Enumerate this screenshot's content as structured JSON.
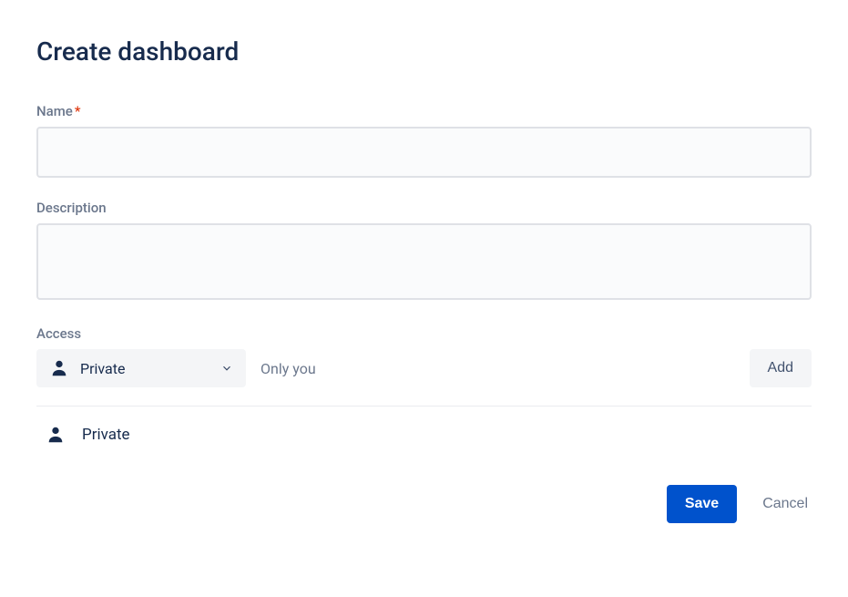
{
  "title": "Create dashboard",
  "fields": {
    "name": {
      "label": "Name",
      "required_marker": "*",
      "value": ""
    },
    "description": {
      "label": "Description",
      "value": ""
    },
    "access": {
      "label": "Access",
      "selected": "Private",
      "detail": "Only you",
      "add_label": "Add",
      "entries": [
        {
          "label": "Private"
        }
      ]
    }
  },
  "footer": {
    "save_label": "Save",
    "cancel_label": "Cancel"
  }
}
